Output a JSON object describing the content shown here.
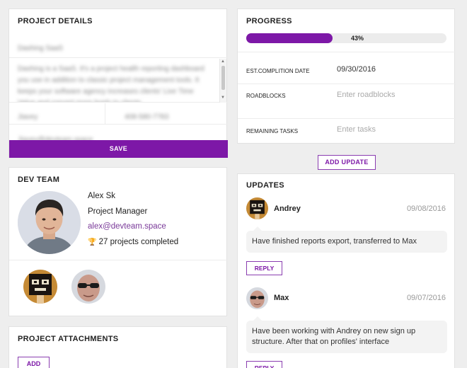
{
  "project_details": {
    "title": "PROJECT DETAILS",
    "name_value": "Dashing SaaS",
    "description_value": "Dashing is a SaaS. It's a project health reporting dashboard you use in addition to classic project management tools. It keeps your software agency increases clients' Live Time Value and convert more leads to clients.",
    "client_value": "Jiavey",
    "phone_value": "408-580-7783",
    "account_value": "Jiavey@devteam.space",
    "save_label": "SAVE"
  },
  "progress": {
    "title": "PROGRESS",
    "percent": 43,
    "percent_label": "43%",
    "completion_label": "EST.COMPLITION DATE",
    "completion_value": "09/30/2016",
    "roadblocks_label": "ROADBLOCKS",
    "roadblocks_placeholder": "Enter roadblocks",
    "remaining_label": "REMAINING TASKS",
    "remaining_placeholder": "Enter tasks"
  },
  "add_update_label": "ADD UPDATE",
  "dev_team": {
    "title": "DEV TEAM",
    "member": {
      "name": "Alex Sk",
      "role": "Project Manager",
      "email": "alex@devteam.space",
      "projects": "27 projects completed"
    }
  },
  "attachments": {
    "title": "PROJECT ATTACHMENTS",
    "add_label": "ADD"
  },
  "updates": {
    "title": "UPDATES",
    "items": [
      {
        "author": "Andrey",
        "date": "09/08/2016",
        "text": "Have finished reports export, transferred to Max",
        "reply_label": "REPLY"
      },
      {
        "author": "Max",
        "date": "09/07/2016",
        "text": "Have been working with Andrey on new sign up structure. After that on profiles' interface",
        "reply_label": "REPLY"
      }
    ]
  },
  "colors": {
    "accent": "#7d18a7",
    "border": "#e2e2e2",
    "background": "#eeeeee"
  }
}
